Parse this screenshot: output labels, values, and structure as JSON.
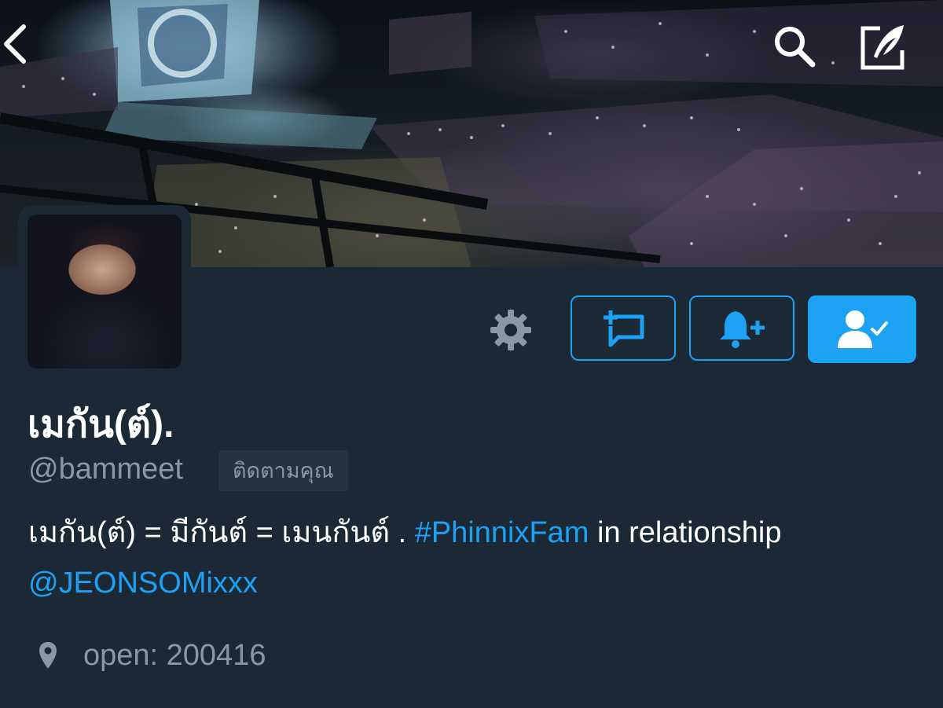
{
  "header": {
    "back_icon": "chevron-left-icon",
    "search_icon": "search-icon",
    "compose_icon": "compose-feather-icon"
  },
  "profile": {
    "display_name": "เมกัน(ต์).",
    "handle": "@bammeet",
    "follows_you_badge": "ติดตามคุณ",
    "bio": {
      "part1": "เมกัน(ต์) = มีกันต์ = เมนกันต์ . ",
      "hashtag": "#PhinnixFam",
      "part2": " in relationship ",
      "mention": "@JEONSOMixxx"
    },
    "location": "open: 200416"
  },
  "actions": {
    "settings_icon": "gear-icon",
    "dm_icon": "direct-message-icon",
    "notify_icon": "bell-plus-icon",
    "following_icon": "user-check-icon"
  },
  "colors": {
    "background": "#1b2836",
    "accent": "#1da1f2",
    "secondary_text": "#8899a6",
    "badge_bg": "#243342"
  }
}
